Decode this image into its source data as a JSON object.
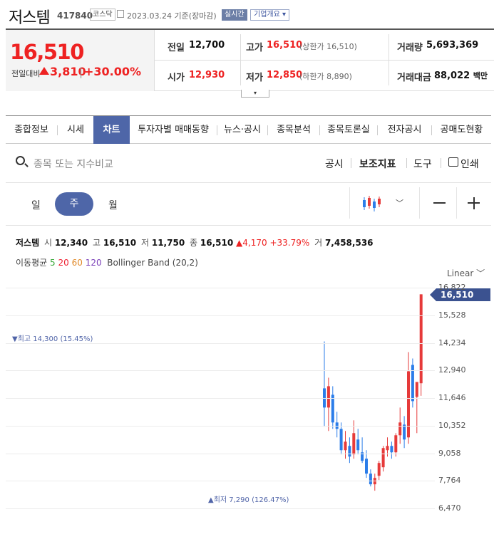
{
  "header": {
    "title": "저스템",
    "code": "417840",
    "market": "코스닥",
    "date": "2023.03.24",
    "basis": "기준(장마감)",
    "realtime": "실시간",
    "company": "기업개요"
  },
  "quote": {
    "price": "16,510",
    "diff_label": "전일대비",
    "diff": "3,810",
    "pct": "+30.00%",
    "prev_label": "전일",
    "prev": "12,700",
    "high_label": "고가",
    "high": "16,510",
    "upper_label": "(상한가",
    "upper": "16,510)",
    "vol_label": "거래량",
    "vol": "5,693,369",
    "open_label": "시가",
    "open": "12,930",
    "low_label": "저가",
    "low": "12,850",
    "lower_label": "(하한가",
    "lower": "8,890)",
    "amt_label": "거래대금",
    "amt": "88,022",
    "amt_unit": "백만"
  },
  "tabs": [
    "종합정보",
    "시세",
    "차트",
    "투자자별 매매동향",
    "뉴스·공시",
    "종목분석",
    "종목토론실",
    "전자공시",
    "공매도현황"
  ],
  "active_tab_index": 2,
  "search": {
    "placeholder": "종목 또는 지수비교"
  },
  "tools": [
    "공시",
    "보조지표",
    "도구",
    "인쇄"
  ],
  "periods": [
    "일",
    "주",
    "월"
  ],
  "stats": {
    "name": "저스템",
    "open_lbl": "시",
    "open": "12,340",
    "high_lbl": "고",
    "high": "16,510",
    "low_lbl": "저",
    "low": "11,750",
    "close_lbl": "종",
    "close": "16,510",
    "chg": "▲4,170",
    "pct": "+33.79%",
    "vol_lbl": "거",
    "vol": "7,458,536"
  },
  "ma": {
    "label": "이동평균",
    "p5": "5",
    "p20": "20",
    "p60": "60",
    "p120": "120",
    "bb": "Bollinger Band (20,2)"
  },
  "scale": "Linear",
  "colors": {
    "up": "#e63a3a",
    "down": "#2b7de9",
    "accent": "#4e66a8"
  },
  "chart_data": {
    "type": "candlestick",
    "y_ticks": [
      "16,822",
      "15,528",
      "14,234",
      "12,940",
      "11,646",
      "10,352",
      "9,058",
      "7,764",
      "6,470"
    ],
    "ylim": [
      6470,
      16822
    ],
    "last_price": "16,510",
    "high_note": "▼최고 14,300 (15.45%)",
    "low_note": "▲최저 7,290 (126.47%)",
    "candles": [
      {
        "o": 12100,
        "h": 14300,
        "l": 10300,
        "c": 11200
      },
      {
        "o": 11200,
        "h": 12600,
        "l": 10100,
        "c": 12200
      },
      {
        "o": 11800,
        "h": 12200,
        "l": 10200,
        "c": 10500
      },
      {
        "o": 10500,
        "h": 11000,
        "l": 9800,
        "c": 10200
      },
      {
        "o": 10200,
        "h": 10500,
        "l": 9000,
        "c": 9200
      },
      {
        "o": 9200,
        "h": 10100,
        "l": 8800,
        "c": 9600
      },
      {
        "o": 9400,
        "h": 9800,
        "l": 8600,
        "c": 8900
      },
      {
        "o": 9000,
        "h": 10600,
        "l": 8800,
        "c": 10000
      },
      {
        "o": 9700,
        "h": 10200,
        "l": 9000,
        "c": 9200
      },
      {
        "o": 9100,
        "h": 9800,
        "l": 8600,
        "c": 8700
      },
      {
        "o": 8800,
        "h": 9200,
        "l": 7900,
        "c": 8100
      },
      {
        "o": 8100,
        "h": 8300,
        "l": 7500,
        "c": 7600
      },
      {
        "o": 7600,
        "h": 8100,
        "l": 7300,
        "c": 7900
      },
      {
        "o": 8000,
        "h": 8700,
        "l": 7800,
        "c": 8600
      },
      {
        "o": 8400,
        "h": 9400,
        "l": 8200,
        "c": 9300
      },
      {
        "o": 9200,
        "h": 9800,
        "l": 8900,
        "c": 9400
      },
      {
        "o": 9400,
        "h": 9600,
        "l": 8800,
        "c": 9100
      },
      {
        "o": 9100,
        "h": 10000,
        "l": 8900,
        "c": 9900
      },
      {
        "o": 9900,
        "h": 11200,
        "l": 9500,
        "c": 10500
      },
      {
        "o": 10400,
        "h": 10800,
        "l": 9300,
        "c": 9700
      },
      {
        "o": 9800,
        "h": 13800,
        "l": 9500,
        "c": 12900
      },
      {
        "o": 13200,
        "h": 13500,
        "l": 11200,
        "c": 11500
      },
      {
        "o": 11700,
        "h": 12000,
        "l": 10000,
        "c": 12400
      },
      {
        "o": 12340,
        "h": 16510,
        "l": 11750,
        "c": 16510
      }
    ]
  }
}
